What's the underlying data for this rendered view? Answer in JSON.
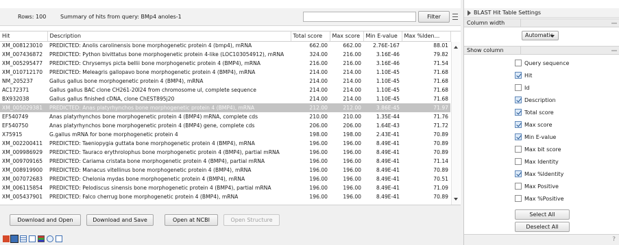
{
  "toolbar": {
    "rows_label": "Rows: 100",
    "summary": "Summary of hits from query: BMp4 anoles-1",
    "filter_value": "",
    "filter_button": "Filter"
  },
  "table": {
    "columns": [
      "Hit",
      "Description",
      "Total score",
      "Max score",
      "Min E-value",
      "Max %Iden..."
    ],
    "rows": [
      [
        "XM_008123010",
        "PREDICTED: Anolis carolinensis bone morphogenetic protein 4 (bmp4), mRNA",
        "662.00",
        "662.00",
        "2.76E-167",
        "88.01"
      ],
      [
        "XM_007436872",
        "PREDICTED: Python bivittatus bone morphogenetic protein 4-like (LOC103054912), mRNA",
        "324.00",
        "216.00",
        "3.16E-46",
        "79.82"
      ],
      [
        "XM_005295477",
        "PREDICTED: Chrysemys picta bellii bone morphogenetic protein 4 (BMP4), mRNA",
        "216.00",
        "216.00",
        "3.16E-46",
        "71.54"
      ],
      [
        "XM_010712170",
        "PREDICTED: Meleagris gallopavo bone morphogenetic protein 4 (BMP4), mRNA",
        "214.00",
        "214.00",
        "1.10E-45",
        "71.68"
      ],
      [
        "NM_205237",
        "Gallus gallus bone morphogenetic protein 4 (BMP4), mRNA",
        "214.00",
        "214.00",
        "1.10E-45",
        "71.68"
      ],
      [
        "AC172371",
        "Gallus gallus BAC clone CH261-20I24 from chromosome ul, complete sequence",
        "214.00",
        "214.00",
        "1.10E-45",
        "71.68"
      ],
      [
        "BX932038",
        "Gallus gallus finished cDNA, clone ChEST895j20",
        "214.00",
        "214.00",
        "1.10E-45",
        "71.68"
      ],
      [
        "XM_005029381",
        "PREDICTED: Anas platyrhynchos bone morphogenetic protein 4 (BMP4), mRNA",
        "212.00",
        "212.00",
        "3.86E-45",
        "71.97"
      ],
      [
        "EF540749",
        "Anas platyrhynchos bone morphogenetic protein 4 (BMP4) mRNA, complete cds",
        "210.00",
        "210.00",
        "1.35E-44",
        "71.76"
      ],
      [
        "EF540750",
        "Anas platyrhynchos bone morphogenetic protein 4 (BMP4) gene, complete cds",
        "206.00",
        "206.00",
        "1.64E-43",
        "71.72"
      ],
      [
        "X75915",
        "G.gallus mRNA for bone morphogenetic protein 4",
        "198.00",
        "198.00",
        "2.43E-41",
        "70.89"
      ],
      [
        "XM_002200411",
        "PREDICTED: Taeniopygia guttata bone morphogenetic protein 4 (BMP4), mRNA",
        "196.00",
        "196.00",
        "8.49E-41",
        "70.89"
      ],
      [
        "XM_009986929",
        "PREDICTED: Tauraco erythrolophus bone morphogenetic protein 4 (BMP4), partial mRNA",
        "196.00",
        "196.00",
        "8.49E-41",
        "70.89"
      ],
      [
        "XM_009709165",
        "PREDICTED: Cariama cristata bone morphogenetic protein 4 (BMP4), partial mRNA",
        "196.00",
        "196.00",
        "8.49E-41",
        "71.14"
      ],
      [
        "XM_008919900",
        "PREDICTED: Manacus vitellinus bone morphogenetic protein 4 (BMP4), mRNA",
        "196.00",
        "196.00",
        "8.49E-41",
        "70.89"
      ],
      [
        "XM_007072683",
        "PREDICTED: Chelonia mydas bone morphogenetic protein 4 (BMP4), mRNA",
        "196.00",
        "196.00",
        "8.49E-41",
        "70.51"
      ],
      [
        "XM_006115854",
        "PREDICTED: Pelodiscus sinensis bone morphogenetic protein 4 (BMP4), partial mRNA",
        "196.00",
        "196.00",
        "8.49E-41",
        "71.09"
      ],
      [
        "XM_005437901",
        "PREDICTED: Falco cherrug bone morphogenetic protein 4 (BMP4), mRNA",
        "196.00",
        "196.00",
        "8.49E-41",
        "70.89"
      ]
    ],
    "selected_row": 7
  },
  "buttons": {
    "download_open": "Download and Open",
    "download_save": "Download and Save",
    "open_ncbi": "Open at NCBI",
    "open_structure": "Open Structure"
  },
  "view_icons": [
    "table-view-icon",
    "graphic-view-icon",
    "grid-view-icon",
    "list-view-icon",
    "chart-view-icon",
    "history-icon",
    "info-icon"
  ],
  "settings": {
    "title": "BLAST Hit Table Settings",
    "column_width_label": "Column width",
    "column_width_value": "Automatic",
    "show_column_label": "Show column",
    "columns": [
      {
        "label": "Query sequence",
        "checked": false
      },
      {
        "label": "Hit",
        "checked": true
      },
      {
        "label": "Id",
        "checked": false
      },
      {
        "label": "Description",
        "checked": true
      },
      {
        "label": "Total score",
        "checked": true
      },
      {
        "label": "Max score",
        "checked": true
      },
      {
        "label": "Min E-value",
        "checked": true
      },
      {
        "label": "Max bit score",
        "checked": false
      },
      {
        "label": "Max Identity",
        "checked": false
      },
      {
        "label": "Max %Identity",
        "checked": true
      },
      {
        "label": "Max Positive",
        "checked": false
      },
      {
        "label": "Max %Positive",
        "checked": false
      }
    ],
    "select_all": "Select All",
    "deselect_all": "Deselect All",
    "help": "?"
  }
}
